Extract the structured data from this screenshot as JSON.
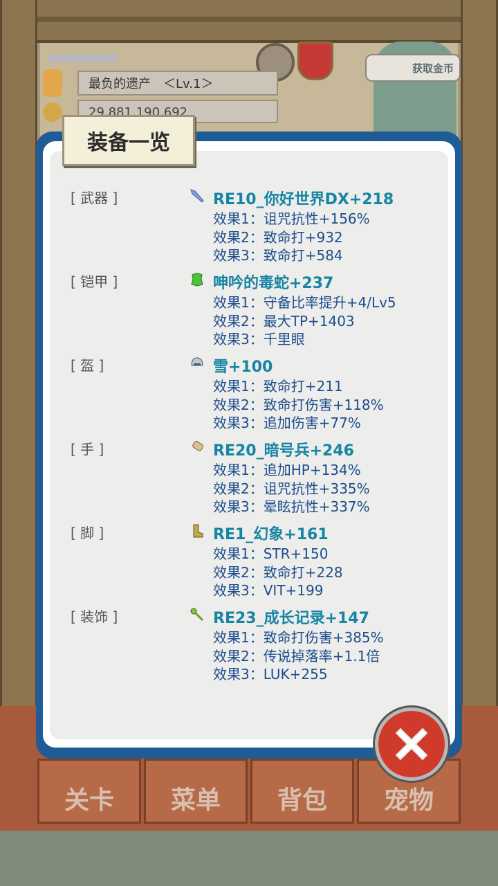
{
  "header": {
    "title_text": "最负的遗产　＜Lv.1＞",
    "gold_text": "29,881,190,692",
    "badge_text": "获取金币"
  },
  "nav_tabs": [
    {
      "label": "关卡"
    },
    {
      "label": "菜单"
    },
    {
      "label": "背包"
    },
    {
      "label": "宠物"
    }
  ],
  "dialog": {
    "title": "装备一览",
    "slots": [
      {
        "slot": "[ 武器 ]",
        "icon": "sword-icon",
        "name": "RE10_你好世界DX+218",
        "effects": [
          "效果1：诅咒抗性+156%",
          "效果2：致命打+932",
          "效果3：致命打+584"
        ]
      },
      {
        "slot": "[ 铠甲 ]",
        "icon": "armor-icon",
        "name": "呻吟的毒蛇+237",
        "effects": [
          "效果1：守备比率提升+4/Lv5",
          "效果2：最大TP+1403",
          "效果3：千里眼"
        ]
      },
      {
        "slot": "[ 盔 ]",
        "icon": "helmet-icon",
        "name": "雪+100",
        "effects": [
          "效果1：致命打+211",
          "效果2：致命打伤害+118%",
          "效果3：追加伤害+77%"
        ]
      },
      {
        "slot": "[ 手 ]",
        "icon": "glove-icon",
        "name": "RE20_暗号兵+246",
        "effects": [
          "效果1：追加HP+134%",
          "效果2：诅咒抗性+335%",
          "效果3：晕眩抗性+337%"
        ]
      },
      {
        "slot": "[ 脚 ]",
        "icon": "boot-icon",
        "name": "RE1_幻象+161",
        "effects": [
          "效果1：STR+150",
          "效果2：致命打+228",
          "效果3：VIT+199"
        ]
      },
      {
        "slot": "[ 装饰 ]",
        "icon": "accessory-icon",
        "name": "RE23_成长记录+147",
        "effects": [
          "效果1：致命打伤害+385%",
          "效果2：传说掉落率+1.1倍",
          "效果3：LUK+255"
        ]
      }
    ]
  },
  "close_button": {
    "icon": "close-icon"
  }
}
